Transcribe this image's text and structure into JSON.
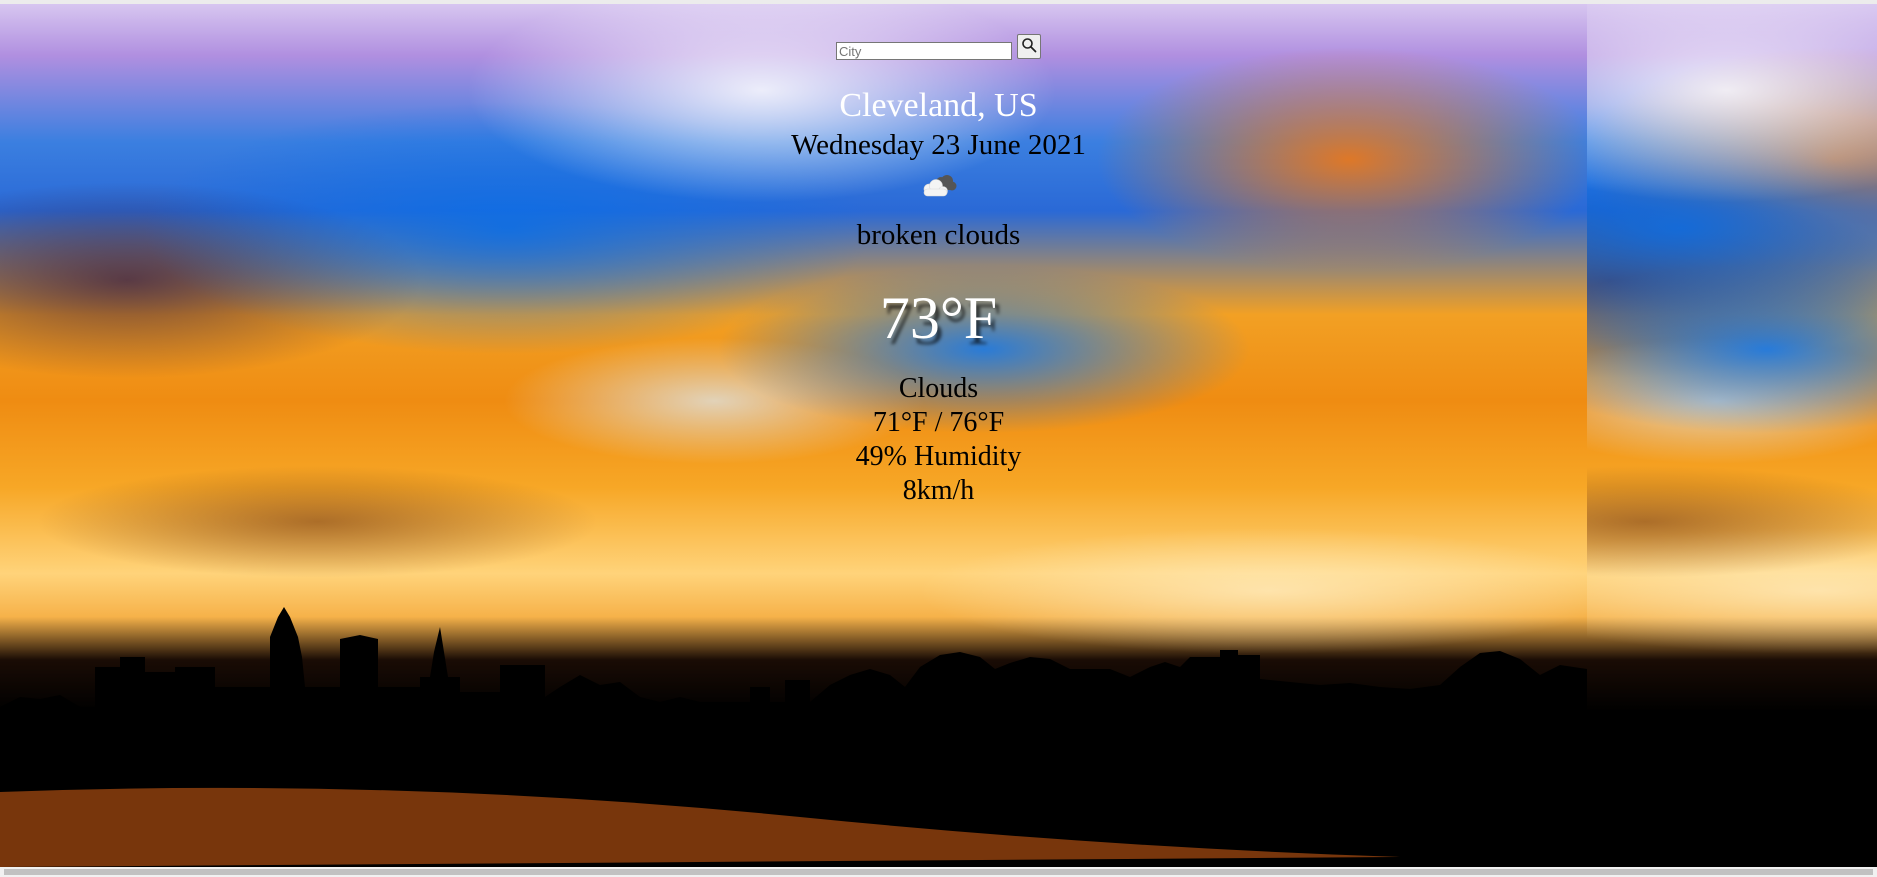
{
  "search": {
    "placeholder": "City",
    "value": "",
    "button_icon": "magnifier-icon"
  },
  "weather": {
    "location": "Cleveland, US",
    "date": "Wednesday 23 June 2021",
    "icon": "broken-clouds-icon",
    "description": "broken clouds",
    "temperature": "73°F",
    "main": "Clouds",
    "low_high": "71°F / 76°F",
    "humidity": "49% Humidity",
    "wind": "8km/h"
  },
  "colors": {
    "location_text": "#ffffff",
    "temperature_text": "#ffffff",
    "body_text": "#000000"
  }
}
